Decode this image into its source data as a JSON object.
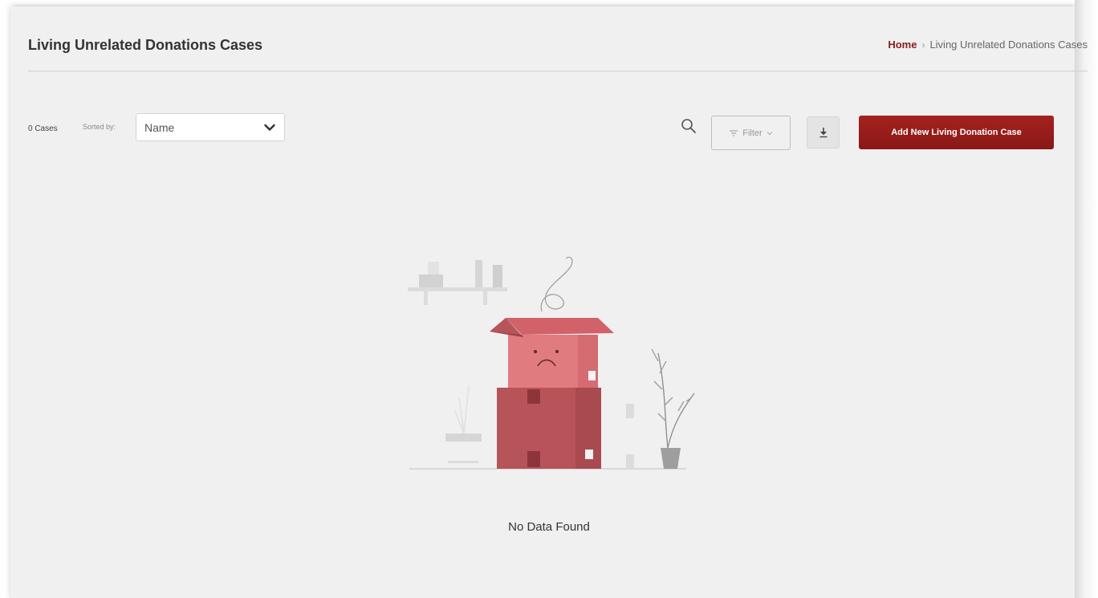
{
  "page": {
    "title": "Living Unrelated Donations Cases"
  },
  "breadcrumb": {
    "home": "Home",
    "separator": "›",
    "current": "Living Unrelated Donations Cases"
  },
  "toolbar": {
    "case_count": "0 Cases",
    "sorted_by_label": "Sorted by:",
    "sort_value": "Name",
    "filter_label": "Filter",
    "add_button_label": "Add New Living Donation Case"
  },
  "empty_state": {
    "message": "No Data Found"
  },
  "icons": {
    "search": "search-icon",
    "filter": "filter-icon",
    "dropdown": "chevron-down-icon",
    "download": "download-icon"
  },
  "colors": {
    "brand": "#8c1c1c",
    "button_bg": "#9a1f1c",
    "card_bg": "#f0f0f0",
    "box_light": "#e07b80",
    "box_dark": "#b7545a"
  }
}
